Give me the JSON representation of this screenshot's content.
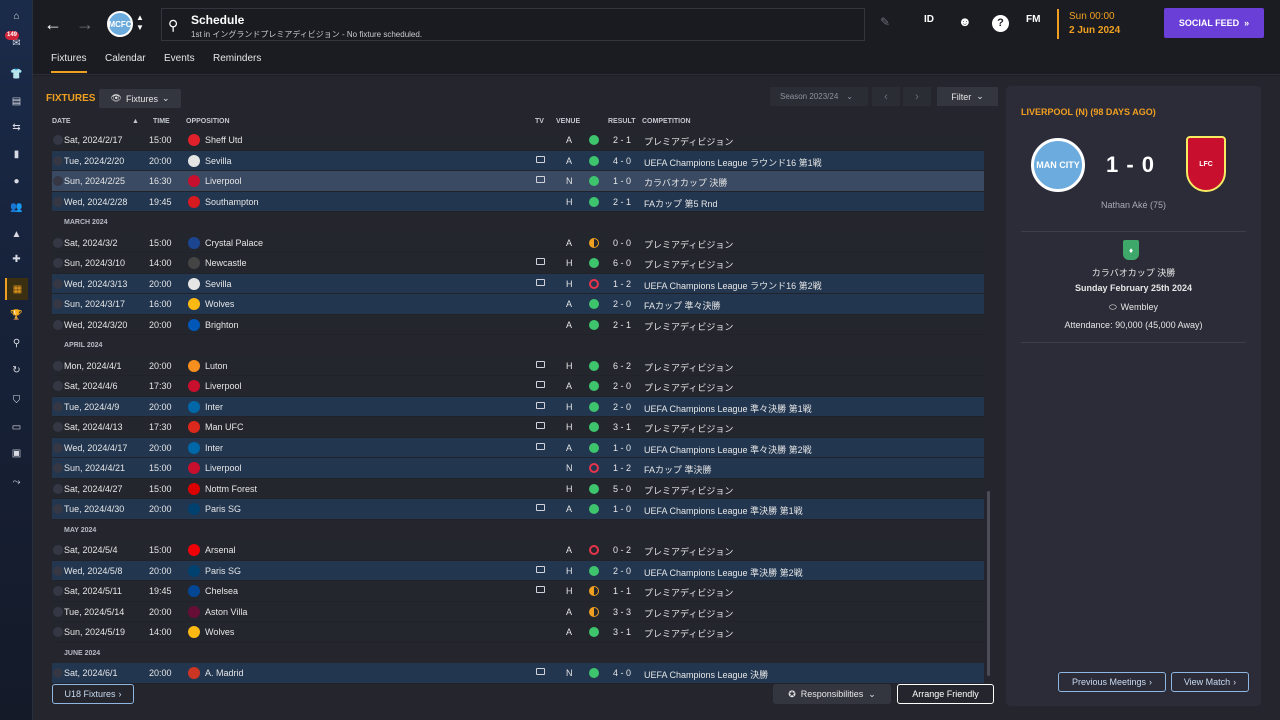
{
  "sidebar": {
    "inbox_badge": "149"
  },
  "topbar": {
    "club_badge_text": "MCFC",
    "search_title": "Schedule",
    "search_subtitle": "1st in イングランドプレミアディビジョン - No fixture scheduled.",
    "icon_id_label": "ID",
    "icon_fm_label": "FM",
    "help_glyph": "?",
    "date_time": "Sun 00:00",
    "date_day": "2 Jun 2024",
    "social_feed_label": "SOCIAL FEED"
  },
  "tabs": [
    "Fixtures",
    "Calendar",
    "Events",
    "Reminders"
  ],
  "fixtures_header": {
    "title": "FIXTURES",
    "view_label": "Fixtures",
    "season": "Season 2023/24",
    "filter_label": "Filter"
  },
  "columns": {
    "date": "DATE",
    "time": "TIME",
    "opposition": "OPPOSITION",
    "tv": "TV",
    "venue": "VENUE",
    "result": "RESULT",
    "competition": "COMPETITION"
  },
  "months": {
    "march": "MARCH 2024",
    "april": "APRIL 2024",
    "may": "MAY 2024",
    "june": "JUNE 2024"
  },
  "fixtures": [
    {
      "date": "Sat, 2024/2/17",
      "time": "15:00",
      "opp": "Sheff Utd",
      "tv": false,
      "venue": "A",
      "result": "2 - 1",
      "outcome": "w",
      "comp": "プレミアディビジョン",
      "crest": "#e0202b",
      "row": "home"
    },
    {
      "date": "Tue, 2024/2/20",
      "time": "20:00",
      "opp": "Sevilla",
      "tv": true,
      "venue": "A",
      "result": "4 - 0",
      "outcome": "w",
      "comp": "UEFA Champions League ラウンド16 第1戦",
      "crest": "#e5e5e5",
      "row": "away"
    },
    {
      "date": "Sun, 2024/2/25",
      "time": "16:30",
      "opp": "Liverpool",
      "tv": true,
      "venue": "N",
      "result": "1 - 0",
      "outcome": "w",
      "comp": "カラバオカップ 決勝",
      "crest": "#c8102e",
      "row": "sel"
    },
    {
      "date": "Wed, 2024/2/28",
      "time": "19:45",
      "opp": "Southampton",
      "tv": false,
      "venue": "H",
      "result": "2 - 1",
      "outcome": "w",
      "comp": "FAカップ 第5 Rnd",
      "crest": "#d71920",
      "row": "away"
    },
    {
      "date": "Sat, 2024/3/2",
      "time": "15:00",
      "opp": "Crystal Palace",
      "tv": false,
      "venue": "A",
      "result": "0 - 0",
      "outcome": "d",
      "comp": "プレミアディビジョン",
      "crest": "#1b458f",
      "row": "home"
    },
    {
      "date": "Sun, 2024/3/10",
      "time": "14:00",
      "opp": "Newcastle",
      "tv": true,
      "venue": "H",
      "result": "6 - 0",
      "outcome": "w",
      "comp": "プレミアディビジョン",
      "crest": "#444444",
      "row": "home"
    },
    {
      "date": "Wed, 2024/3/13",
      "time": "20:00",
      "opp": "Sevilla",
      "tv": true,
      "venue": "H",
      "result": "1 - 2",
      "outcome": "l",
      "comp": "UEFA Champions League ラウンド16 第2戦",
      "crest": "#e5e5e5",
      "row": "away"
    },
    {
      "date": "Sun, 2024/3/17",
      "time": "16:00",
      "opp": "Wolves",
      "tv": false,
      "venue": "A",
      "result": "2 - 0",
      "outcome": "w",
      "comp": "FAカップ 準々決勝",
      "crest": "#fdb913",
      "row": "away"
    },
    {
      "date": "Wed, 2024/3/20",
      "time": "20:00",
      "opp": "Brighton",
      "tv": false,
      "venue": "A",
      "result": "2 - 1",
      "outcome": "w",
      "comp": "プレミアディビジョン",
      "crest": "#0057b8",
      "row": "home"
    },
    {
      "date": "Mon, 2024/4/1",
      "time": "20:00",
      "opp": "Luton",
      "tv": true,
      "venue": "H",
      "result": "6 - 2",
      "outcome": "w",
      "comp": "プレミアディビジョン",
      "crest": "#f78f1e",
      "row": "home"
    },
    {
      "date": "Sat, 2024/4/6",
      "time": "17:30",
      "opp": "Liverpool",
      "tv": true,
      "venue": "A",
      "result": "2 - 0",
      "outcome": "w",
      "comp": "プレミアディビジョン",
      "crest": "#c8102e",
      "row": "home"
    },
    {
      "date": "Tue, 2024/4/9",
      "time": "20:00",
      "opp": "Inter",
      "tv": true,
      "venue": "H",
      "result": "2 - 0",
      "outcome": "w",
      "comp": "UEFA Champions League 準々決勝 第1戦",
      "crest": "#0068a8",
      "row": "away"
    },
    {
      "date": "Sat, 2024/4/13",
      "time": "17:30",
      "opp": "Man UFC",
      "tv": true,
      "venue": "H",
      "result": "3 - 1",
      "outcome": "w",
      "comp": "プレミアディビジョン",
      "crest": "#da291c",
      "row": "home"
    },
    {
      "date": "Wed, 2024/4/17",
      "time": "20:00",
      "opp": "Inter",
      "tv": true,
      "venue": "A",
      "result": "1 - 0",
      "outcome": "w",
      "comp": "UEFA Champions League 準々決勝 第2戦",
      "crest": "#0068a8",
      "row": "away"
    },
    {
      "date": "Sun, 2024/4/21",
      "time": "15:00",
      "opp": "Liverpool",
      "tv": false,
      "venue": "N",
      "result": "1 - 2",
      "outcome": "l",
      "comp": "FAカップ 準決勝",
      "crest": "#c8102e",
      "row": "away"
    },
    {
      "date": "Sat, 2024/4/27",
      "time": "15:00",
      "opp": "Nottm Forest",
      "tv": false,
      "venue": "H",
      "result": "5 - 0",
      "outcome": "w",
      "comp": "プレミアディビジョン",
      "crest": "#dd0000",
      "row": "home"
    },
    {
      "date": "Tue, 2024/4/30",
      "time": "20:00",
      "opp": "Paris SG",
      "tv": true,
      "venue": "A",
      "result": "1 - 0",
      "outcome": "w",
      "comp": "UEFA Champions League 準決勝 第1戦",
      "crest": "#004170",
      "row": "away"
    },
    {
      "date": "Sat, 2024/5/4",
      "time": "15:00",
      "opp": "Arsenal",
      "tv": false,
      "venue": "A",
      "result": "0 - 2",
      "outcome": "l",
      "comp": "プレミアディビジョン",
      "crest": "#ef0107",
      "row": "home"
    },
    {
      "date": "Wed, 2024/5/8",
      "time": "20:00",
      "opp": "Paris SG",
      "tv": true,
      "venue": "H",
      "result": "2 - 0",
      "outcome": "w",
      "comp": "UEFA Champions League 準決勝 第2戦",
      "crest": "#004170",
      "row": "away"
    },
    {
      "date": "Sat, 2024/5/11",
      "time": "19:45",
      "opp": "Chelsea",
      "tv": true,
      "venue": "H",
      "result": "1 - 1",
      "outcome": "d",
      "comp": "プレミアディビジョン",
      "crest": "#034694",
      "row": "home"
    },
    {
      "date": "Tue, 2024/5/14",
      "time": "20:00",
      "opp": "Aston Villa",
      "tv": false,
      "venue": "A",
      "result": "3 - 3",
      "outcome": "d",
      "comp": "プレミアディビジョン",
      "crest": "#670e36",
      "row": "home"
    },
    {
      "date": "Sun, 2024/5/19",
      "time": "14:00",
      "opp": "Wolves",
      "tv": false,
      "venue": "A",
      "result": "3 - 1",
      "outcome": "w",
      "comp": "プレミアディビジョン",
      "crest": "#fdb913",
      "row": "home"
    },
    {
      "date": "Sat, 2024/6/1",
      "time": "20:00",
      "opp": "A. Madrid",
      "tv": true,
      "venue": "N",
      "result": "4 - 0",
      "outcome": "w",
      "comp": "UEFA Champions League 決勝",
      "crest": "#cb3524",
      "row": "away"
    }
  ],
  "footer": {
    "u18_label": "U18 Fixtures",
    "responsibilities_label": "Responsibilities",
    "arrange_label": "Arrange Friendly"
  },
  "panel": {
    "title": "LIVERPOOL (N) (98 DAYS AGO)",
    "home_badge": "MAN CITY",
    "away_badge": "LFC",
    "score": "1 - 0",
    "scorer": "Nathan Aké (75)",
    "competition": "カラバオカップ 決勝",
    "match_date": "Sunday February 25th 2024",
    "stadium": "Wembley",
    "attendance": "Attendance: 90,000 (45,000 Away)",
    "previous_meetings_label": "Previous Meetings",
    "view_match_label": "View Match"
  },
  "colors": {
    "accent": "#f0a020",
    "win": "#3ec46d",
    "loss": "#e8334a",
    "social": "#6a3fd8",
    "away_row": "#223650"
  }
}
